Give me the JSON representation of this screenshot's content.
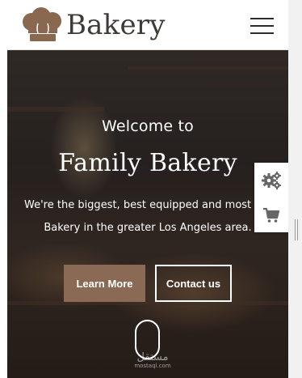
{
  "header": {
    "logo_text": "Bakery",
    "logo_icon": "chef-hat-icon",
    "menu_icon": "hamburger-menu-icon"
  },
  "hero": {
    "welcome": "Welcome to",
    "title": "Family Bakery",
    "description_line1": "We're the biggest, best equipped and most advan",
    "description_line2": "Bakery in the greater Los Angeles area.",
    "learn_more_label": "Learn More",
    "contact_label": "Contact us",
    "scroll_icon": "mouse-scroll-icon"
  },
  "watermark": {
    "arabic": "مستقل",
    "latin": "mostaql.com"
  },
  "side_widget": {
    "settings_icon": "gears-icon",
    "cart_icon": "cart-icon"
  },
  "colors": {
    "brand_brown": "#8b6a55",
    "header_text": "#3d3a37",
    "logo_hat": "#8a684f",
    "icon_gray": "#666666"
  }
}
